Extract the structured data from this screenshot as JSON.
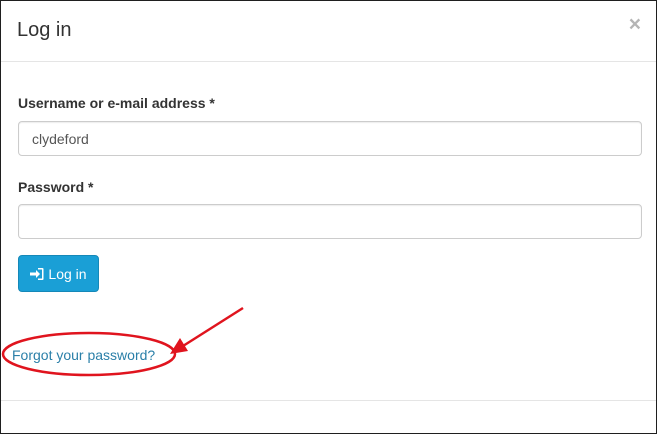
{
  "modal": {
    "title": "Log in",
    "close_label": "×"
  },
  "form": {
    "username_label": "Username or e-mail address *",
    "username_value": "clydeford",
    "password_label": "Password *",
    "password_value": "",
    "login_button_label": "Log in",
    "login_icon": "sign-in-icon",
    "forgot_link": "Forgot your password?"
  },
  "colors": {
    "button_bg": "#1a9fd6",
    "link": "#2a7fa8",
    "annotation": "#e0141e"
  }
}
